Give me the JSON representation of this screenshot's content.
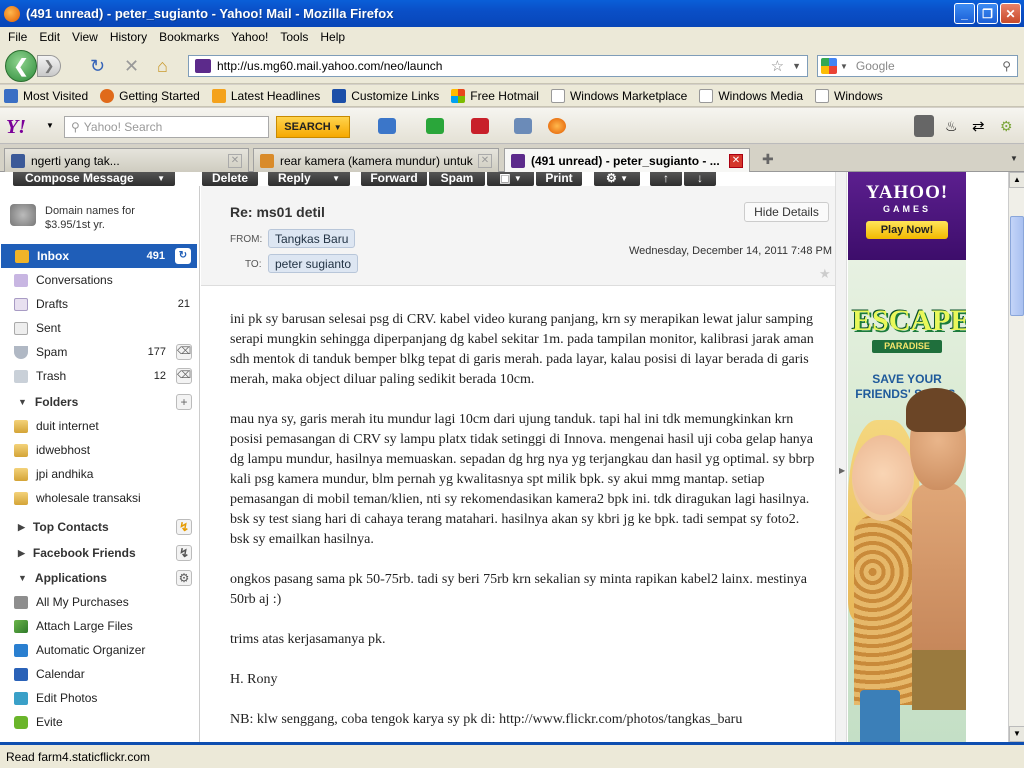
{
  "window": {
    "title": "(491 unread) - peter_sugianto - Yahoo! Mail - Mozilla Firefox",
    "buttons": [
      "_",
      "❐",
      "✕"
    ]
  },
  "menu": [
    "File",
    "Edit",
    "View",
    "History",
    "Bookmarks",
    "Yahoo!",
    "Tools",
    "Help"
  ],
  "nav": {
    "url": "http://us.mg60.mail.yahoo.com/neo/launch",
    "search_placeholder": "Google"
  },
  "bookmarks": [
    {
      "label": "Most Visited",
      "color": "#3a6fc4"
    },
    {
      "label": "Getting Started",
      "color": "#e06a1a"
    },
    {
      "label": "Latest Headlines",
      "color": "#f4a21c"
    },
    {
      "label": "Customize Links",
      "color": "#1c4fa8"
    },
    {
      "label": "Free Hotmail",
      "color": "#e8451c"
    },
    {
      "label": "Windows Marketplace",
      "color": "#ffffff"
    },
    {
      "label": "Windows Media",
      "color": "#ffffff"
    },
    {
      "label": "Windows",
      "color": "#ffffff"
    }
  ],
  "ytoolbar": {
    "logo": "Y!",
    "search_placeholder": "Yahoo! Search",
    "search_button": "SEARCH"
  },
  "tabs": [
    {
      "label": "ngerti yang tak...",
      "icon": "facebook-icon",
      "active": false
    },
    {
      "label": "rear kamera (kamera mundur) untuk m...",
      "icon": "forum-icon",
      "active": false
    },
    {
      "label": "(491 unread) - peter_sugianto - ...",
      "icon": "yahoo-mail-icon",
      "active": true
    }
  ],
  "mail_toolbar": {
    "compose": "Compose Message",
    "delete": "Delete",
    "reply": "Reply",
    "forward": "Forward",
    "spam": "Spam",
    "print": "Print"
  },
  "sidebar": {
    "promo": [
      "Domain names for",
      "$3.95/1st yr."
    ],
    "items": [
      {
        "label": "Inbox",
        "count": "491"
      },
      {
        "label": "Conversations",
        "count": ""
      },
      {
        "label": "Drafts",
        "count": "21"
      },
      {
        "label": "Sent",
        "count": ""
      },
      {
        "label": "Spam",
        "count": "177"
      },
      {
        "label": "Trash",
        "count": "12"
      }
    ],
    "folders_title": "Folders",
    "folders": [
      "duit internet",
      "idwebhost",
      "jpi andhika",
      "wholesale transaksi"
    ],
    "top_contacts": "Top Contacts",
    "facebook_friends": "Facebook Friends",
    "applications_title": "Applications",
    "applications": [
      "All My Purchases",
      "Attach Large Files",
      "Automatic Organizer",
      "Calendar",
      "Edit Photos",
      "Evite"
    ]
  },
  "message": {
    "subject": "Re: ms01 detil",
    "hide_details": "Hide Details",
    "from_label": "FROM:",
    "from": "Tangkas Baru",
    "to_label": "TO:",
    "to": "peter sugianto",
    "date": "Wednesday, December 14, 2011 7:48 PM",
    "paragraphs": [
      "ini pk sy barusan selesai psg di CRV. kabel video kurang panjang, krn sy merapikan lewat jalur samping serapi mungkin sehingga diperpanjang dg kabel sekitar 1m. pada tampilan monitor, kalibrasi jarak aman sdh mentok di tanduk bemper blkg tepat di garis merah. pada layar, kalau posisi di layar berada di garis merah, maka object diluar paling sedikit berada 10cm.",
      "mau nya sy, garis merah itu mundur lagi 10cm dari ujung tanduk. tapi hal ini tdk memungkinkan krn posisi pemasangan di CRV sy lampu platx tidak setinggi di Innova. mengenai hasil uji coba gelap hanya dg lampu mundur, hasilnya memuaskan. sepadan dg hrg nya yg terjangkau dan hasil yg optimal. sy bbrp kali psg kamera mundur, blm pernah yg kwalitasnya spt milik bpk. sy akui mmg mantap. setiap pemasangan di mobil teman/klien, nti sy rekomendasikan kamera2 bpk ini. tdk diragukan lagi hasilnya. bsk sy test siang hari di cahaya terang matahari. hasilnya akan sy kbri jg ke bpk. tadi sempat sy foto2. bsk sy emailkan hasilnya.",
      "ongkos pasang sama pk 50-75rb. tadi sy beri 75rb krn sekalian sy minta rapikan kabel2 lainx. mestinya 50rb aj :)",
      "trims atas kerjasamanya pk.",
      "H. Rony",
      "NB: klw senggang, coba tengok karya sy pk di: http://www.flickr.com/photos/tangkas_baru"
    ]
  },
  "ads": {
    "games_brand": "YAHOO!",
    "games_sub": "GAMES",
    "games_button": "Play Now!",
    "escape": "ESCAPE",
    "escape_sub": "PARADISE",
    "save_line1": "SAVE YOUR",
    "save_line2": "FRIENDS' SOULS."
  },
  "status": "Read farm4.staticflickr.com"
}
